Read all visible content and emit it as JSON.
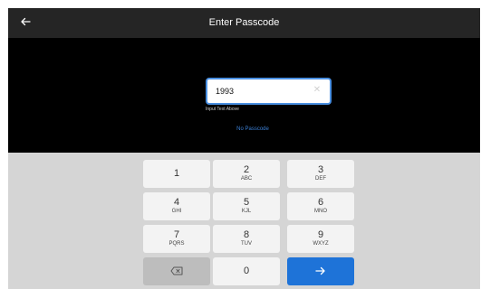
{
  "header": {
    "title": "Enter Passcode",
    "back_icon": "arrow-left-icon"
  },
  "form": {
    "input_value": "1993",
    "clear_icon": "close-icon",
    "hint": "Input Text Above",
    "no_passcode_label": "No Passcode"
  },
  "keypad": {
    "keys": [
      {
        "digit": "1",
        "letters": ""
      },
      {
        "digit": "2",
        "letters": "ABC"
      },
      {
        "digit": "3",
        "letters": "DEF"
      },
      {
        "digit": "4",
        "letters": "GHI"
      },
      {
        "digit": "5",
        "letters": "KJL"
      },
      {
        "digit": "6",
        "letters": "MNO"
      },
      {
        "digit": "7",
        "letters": "PQRS"
      },
      {
        "digit": "8",
        "letters": "TUV"
      },
      {
        "digit": "9",
        "letters": "WXYZ"
      }
    ],
    "backspace_icon": "backspace-icon",
    "zero": "0",
    "enter_icon": "arrow-right-icon"
  },
  "colors": {
    "accent": "#1e73d8",
    "header_bg": "#252525",
    "keypad_bg": "#d5d5d5"
  }
}
